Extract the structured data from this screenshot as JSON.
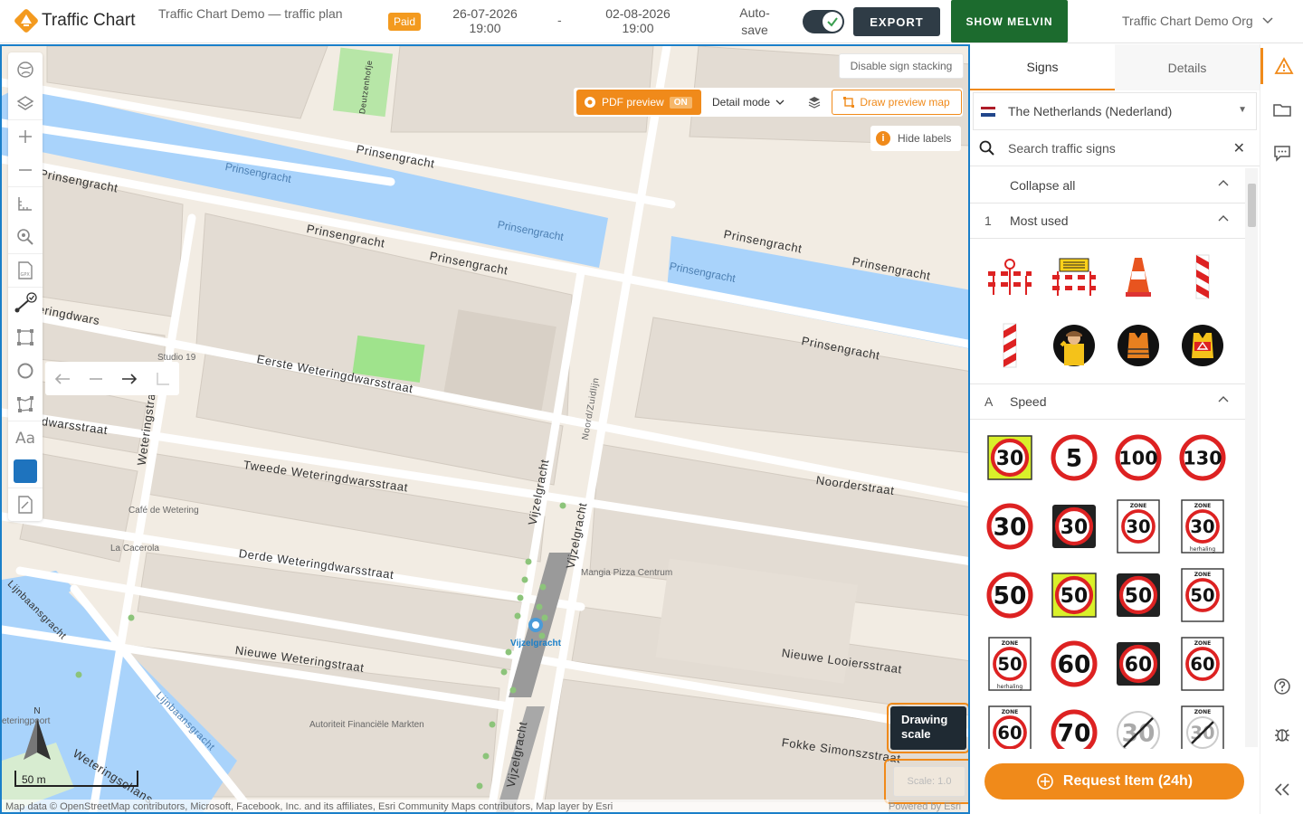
{
  "app": {
    "name": "Traffic Chart",
    "plan_title": "Traffic Chart Demo — traffic plan",
    "paid_badge": "Paid"
  },
  "dates": {
    "start": "26-07-2026 19:00",
    "separator": "-",
    "end": "02-08-2026 19:00"
  },
  "autosave": {
    "label": "Auto-save",
    "enabled": true
  },
  "buttons": {
    "export": "EXPORT",
    "show_melvin": "SHOW MELVIN"
  },
  "org": {
    "name": "Traffic Chart Demo Org"
  },
  "map": {
    "stack_button": "Disable sign stacking",
    "pdf_preview": "PDF preview",
    "pdf_on": "ON",
    "detail_mode": "Detail mode",
    "draw_preview": "Draw preview map",
    "hide_labels": "Hide labels",
    "drawing_scale": "Drawing scale",
    "scale_value": "Scale: 1.0",
    "powered_by": "Powered by Esri",
    "attribution": "Map data © OpenStreetMap contributors, Microsoft, Facebook, Inc. and its affiliates, Esri Community Maps contributors, Map layer by Esri",
    "north": "N",
    "scalebar": "50 m",
    "streets": {
      "prinsengracht": "Prinsengracht",
      "eerste": "Eerste Weteringdwarsstraat",
      "tweede": "Tweede Weteringdwarsstraat",
      "derde": "Derde Weteringdwarsstraat",
      "nieuwe_weteringstraat": "Nieuwe Weteringstraat",
      "vijzelgracht": "Vijzelgracht",
      "noorderstraat": "Noorderstraat",
      "nieuwe_looiersstraat": "Nieuwe Looiersstraat",
      "fokke": "Fokke Simonszstraat",
      "lijnbaansgracht": "Lijnbaansgracht",
      "weteringstraat": "Weteringstraat",
      "deutzenhofje": "Deutzenhofje",
      "noord_zuidlijn": "Noord/Zuidlijn",
      "weteringschans": "Weteringschans",
      "weteringdwars": "eringdwars",
      "dwarsstraat": "dwarsstraat",
      "wetering_poort": "eteringpoort",
      "racht": "racht"
    },
    "pois": {
      "studio19": "Studio 19",
      "cafe": "Café de Wetering",
      "la_cacerola": "La Cacerola",
      "mangia": "Mangia Pizza Centrum",
      "autoriteit": "Autoriteit Financiële Markten",
      "vijzelgracht_stop": "Vijzelgracht"
    }
  },
  "panel": {
    "tabs": [
      "Signs",
      "Details"
    ],
    "active_tab": "Signs",
    "country": "The Netherlands (Nederland)",
    "search_placeholder": "Search traffic signs",
    "collapse_all": "Collapse all",
    "sections": [
      {
        "index": "1",
        "label": "Most used"
      },
      {
        "index": "A",
        "label": "Speed"
      }
    ],
    "speed_signs": [
      "30",
      "5",
      "100",
      "130",
      "30",
      "30",
      "30",
      "30",
      "50",
      "50",
      "50",
      "50",
      "50",
      "60",
      "60",
      "60",
      "60",
      "70",
      "30",
      "30"
    ],
    "zone_text": "ZONE",
    "herhaling_text": "herhaling",
    "request_button": "Request Item (24h)"
  },
  "colors": {
    "accent": "#f08a1a",
    "dark": "#2f3c46",
    "melvin": "#1c6b2e",
    "map_border": "#1a7fc9",
    "water": "#a9d3fb"
  }
}
